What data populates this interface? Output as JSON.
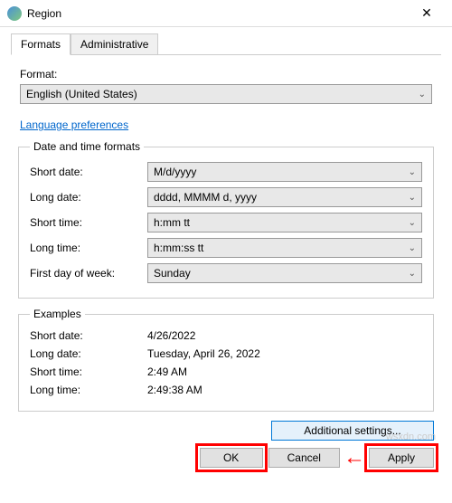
{
  "window": {
    "title": "Region",
    "close_glyph": "✕"
  },
  "tabs": {
    "formats": "Formats",
    "administrative": "Administrative"
  },
  "format_label": "Format:",
  "format_value": "English (United States)",
  "lang_prefs": "Language preferences",
  "group_datetime": {
    "legend": "Date and time formats",
    "short_date_label": "Short date:",
    "short_date_value": "M/d/yyyy",
    "long_date_label": "Long date:",
    "long_date_value": "dddd, MMMM d, yyyy",
    "short_time_label": "Short time:",
    "short_time_value": "h:mm tt",
    "long_time_label": "Long time:",
    "long_time_value": "h:mm:ss tt",
    "first_day_label": "First day of week:",
    "first_day_value": "Sunday"
  },
  "group_examples": {
    "legend": "Examples",
    "short_date_label": "Short date:",
    "short_date_value": "4/26/2022",
    "long_date_label": "Long date:",
    "long_date_value": "Tuesday, April 26, 2022",
    "short_time_label": "Short time:",
    "short_time_value": "2:49 AM",
    "long_time_label": "Long time:",
    "long_time_value": "2:49:38 AM"
  },
  "buttons": {
    "additional": "Additional settings...",
    "ok": "OK",
    "cancel": "Cancel",
    "apply": "Apply"
  },
  "watermark": "wsxdn.com",
  "chevron": "⌄"
}
